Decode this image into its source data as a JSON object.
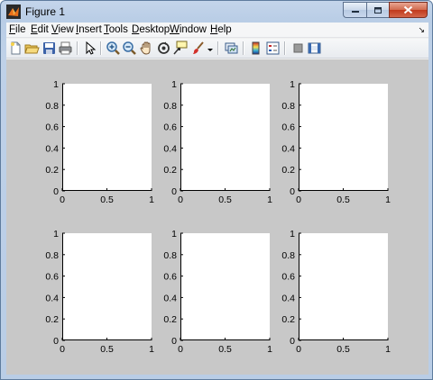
{
  "window": {
    "title": "Figure 1"
  },
  "menu": [
    {
      "key": "F",
      "rest": "ile"
    },
    {
      "key": "E",
      "rest": "dit"
    },
    {
      "key": "V",
      "rest": "iew"
    },
    {
      "key": "I",
      "rest": "nsert"
    },
    {
      "key": "T",
      "rest": "ools"
    },
    {
      "key": "D",
      "rest": "esktop"
    },
    {
      "key": "W",
      "rest": "indow"
    },
    {
      "key": "H",
      "rest": "elp"
    }
  ],
  "toolbar": [
    "new-figure-icon",
    "open-file-icon",
    "save-icon",
    "print-icon",
    "edit-plot-arrow-icon",
    "zoom-in-icon",
    "zoom-out-icon",
    "pan-hand-icon",
    "rotate-3d-icon",
    "data-cursor-icon",
    "brush-icon",
    "link-plot-icon",
    "insert-colorbar-icon",
    "insert-legend-icon",
    "hide-plot-tools-icon",
    "show-plot-tools-icon"
  ],
  "chart_data": [
    {
      "type": "line",
      "xlim": [
        0,
        1
      ],
      "ylim": [
        0,
        1
      ],
      "xticks": [
        "0",
        "0.5",
        "1"
      ],
      "yticks": [
        "0",
        "0.2",
        "0.4",
        "0.6",
        "0.8",
        "1"
      ],
      "series": []
    },
    {
      "type": "line",
      "xlim": [
        0,
        1
      ],
      "ylim": [
        0,
        1
      ],
      "xticks": [
        "0",
        "0.5",
        "1"
      ],
      "yticks": [
        "0",
        "0.2",
        "0.4",
        "0.6",
        "0.8",
        "1"
      ],
      "series": []
    },
    {
      "type": "line",
      "xlim": [
        0,
        1
      ],
      "ylim": [
        0,
        1
      ],
      "xticks": [
        "0",
        "0.5",
        "1"
      ],
      "yticks": [
        "0",
        "0.2",
        "0.4",
        "0.6",
        "0.8",
        "1"
      ],
      "series": []
    },
    {
      "type": "line",
      "xlim": [
        0,
        1
      ],
      "ylim": [
        0,
        1
      ],
      "xticks": [
        "0",
        "0.5",
        "1"
      ],
      "yticks": [
        "0",
        "0.2",
        "0.4",
        "0.6",
        "0.8",
        "1"
      ],
      "series": []
    },
    {
      "type": "line",
      "xlim": [
        0,
        1
      ],
      "ylim": [
        0,
        1
      ],
      "xticks": [
        "0",
        "0.5",
        "1"
      ],
      "yticks": [
        "0",
        "0.2",
        "0.4",
        "0.6",
        "0.8",
        "1"
      ],
      "series": []
    },
    {
      "type": "line",
      "xlim": [
        0,
        1
      ],
      "ylim": [
        0,
        1
      ],
      "xticks": [
        "0",
        "0.5",
        "1"
      ],
      "yticks": [
        "0",
        "0.2",
        "0.4",
        "0.6",
        "0.8",
        "1"
      ],
      "series": []
    }
  ]
}
